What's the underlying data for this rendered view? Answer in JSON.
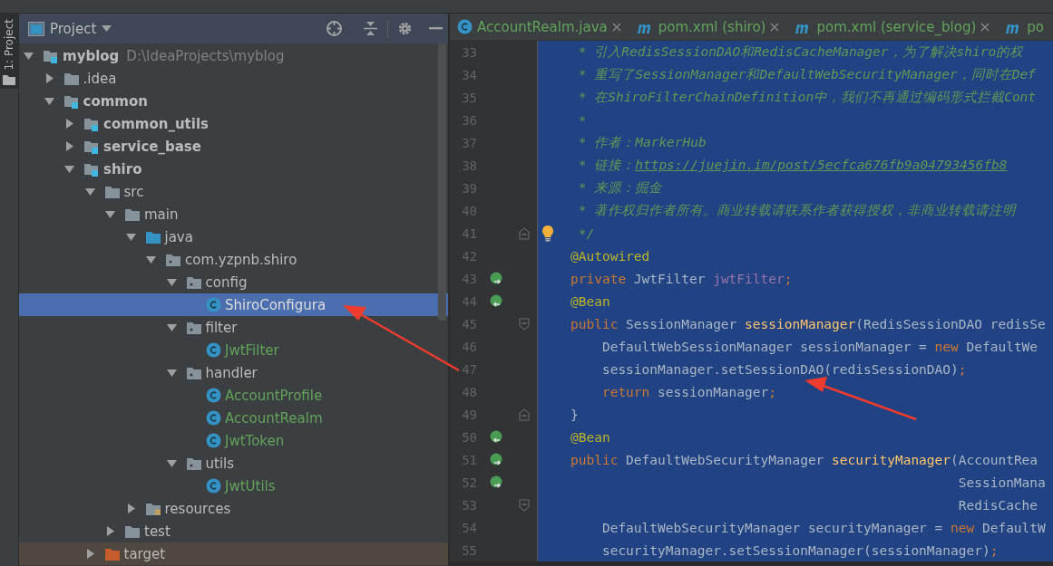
{
  "side_stripe": {
    "label": "1: Project"
  },
  "project_panel": {
    "title": "Project",
    "tree": [
      {
        "label": "myblog",
        "kind": "module",
        "path": "D:\\IdeaProjects\\myblog",
        "expanded": true,
        "selected": false,
        "children": [
          {
            "label": ".idea",
            "kind": "folder",
            "expanded": false,
            "selected": false
          },
          {
            "label": "common",
            "kind": "module",
            "expanded": true,
            "selected": false,
            "children": [
              {
                "label": "common_utils",
                "kind": "module",
                "expanded": false,
                "selected": false
              },
              {
                "label": "service_base",
                "kind": "module",
                "expanded": false,
                "selected": false
              },
              {
                "label": "shiro",
                "kind": "module",
                "expanded": true,
                "selected": false,
                "children": [
                  {
                    "label": "src",
                    "kind": "folder",
                    "expanded": true,
                    "selected": false,
                    "children": [
                      {
                        "label": "main",
                        "kind": "folder",
                        "expanded": true,
                        "selected": false,
                        "children": [
                          {
                            "label": "java",
                            "kind": "source",
                            "expanded": true,
                            "selected": false,
                            "children": [
                              {
                                "label": "com.yzpnb.shiro",
                                "kind": "package",
                                "expanded": true,
                                "selected": false,
                                "children": [
                                  {
                                    "label": "config",
                                    "kind": "package",
                                    "expanded": true,
                                    "selected": false,
                                    "children": [
                                      {
                                        "label": "ShiroConfigura",
                                        "kind": "class",
                                        "selected": true
                                      }
                                    ]
                                  },
                                  {
                                    "label": "filter",
                                    "kind": "package",
                                    "expanded": true,
                                    "selected": false,
                                    "children": [
                                      {
                                        "label": "JwtFilter",
                                        "kind": "class",
                                        "selected": false
                                      }
                                    ]
                                  },
                                  {
                                    "label": "handler",
                                    "kind": "package",
                                    "expanded": true,
                                    "selected": false,
                                    "children": [
                                      {
                                        "label": "AccountProfile",
                                        "kind": "class",
                                        "selected": false
                                      },
                                      {
                                        "label": "AccountRealm",
                                        "kind": "class",
                                        "selected": false
                                      },
                                      {
                                        "label": "JwtToken",
                                        "kind": "class",
                                        "selected": false
                                      }
                                    ]
                                  },
                                  {
                                    "label": "utils",
                                    "kind": "package",
                                    "expanded": true,
                                    "selected": false,
                                    "children": [
                                      {
                                        "label": "JwtUtils",
                                        "kind": "class",
                                        "selected": false
                                      }
                                    ]
                                  }
                                ]
                              }
                            ]
                          },
                          {
                            "label": "resources",
                            "kind": "resources",
                            "expanded": false,
                            "selected": false
                          }
                        ]
                      },
                      {
                        "label": "test",
                        "kind": "folder",
                        "expanded": false,
                        "selected": false
                      }
                    ]
                  },
                  {
                    "label": "target",
                    "kind": "excluded",
                    "expanded": false,
                    "selected": false
                  }
                ]
              }
            ]
          }
        ]
      }
    ]
  },
  "editor": {
    "tabs": [
      {
        "label": "AccountRealm.java",
        "kind": "class"
      },
      {
        "label": "pom.xml (shiro)",
        "kind": "maven"
      },
      {
        "label": "pom.xml (service_blog)",
        "kind": "maven"
      },
      {
        "label": "po",
        "kind": "maven"
      }
    ],
    "lines": [
      {
        "number": "33",
        "selected": true,
        "tokens": [
          {
            "kind": "comment",
            "text": " * 引入RedisSessionDAO和RedisCacheManager，为了解决shiro的权"
          }
        ]
      },
      {
        "number": "34",
        "selected": true,
        "tokens": [
          {
            "kind": "comment",
            "text": " * 重写了SessionManager和DefaultWebSecurityManager，同时在Def"
          }
        ]
      },
      {
        "number": "35",
        "selected": true,
        "tokens": [
          {
            "kind": "comment",
            "text": " * 在ShiroFilterChainDefinition中，我们不再通过编码形式拦截Cont"
          }
        ]
      },
      {
        "number": "36",
        "selected": true,
        "tokens": [
          {
            "kind": "comment",
            "text": " *"
          }
        ]
      },
      {
        "number": "37",
        "selected": true,
        "tokens": [
          {
            "kind": "comment",
            "text": " * 作者：MarkerHub"
          }
        ]
      },
      {
        "number": "38",
        "selected": true,
        "tokens": [
          {
            "kind": "comment",
            "text": " * 链接："
          },
          {
            "kind": "link",
            "text": "https://juejin.im/post/5ecfca676fb9a04793456fb8"
          }
        ]
      },
      {
        "number": "39",
        "selected": true,
        "tokens": [
          {
            "kind": "comment",
            "text": " * 来源：掘金"
          }
        ]
      },
      {
        "number": "40",
        "selected": true,
        "tokens": [
          {
            "kind": "comment",
            "text": " * 著作权归作者所有。商业转载请联系作者获得授权，非商业转载请注明"
          }
        ]
      },
      {
        "number": "41",
        "selected": true,
        "gutter": [
          {
            "kind": "bulb"
          },
          {
            "kind": "fold-end"
          }
        ],
        "tokens": [
          {
            "kind": "comment",
            "text": " */"
          }
        ]
      },
      {
        "number": "42",
        "selected": true,
        "tokens": [
          {
            "kind": "annotation",
            "text": "@Autowired"
          }
        ]
      },
      {
        "number": "43",
        "selected": true,
        "gutter": [
          {
            "kind": "bean-out"
          }
        ],
        "tokens": [
          {
            "kind": "keyword",
            "text": "private "
          },
          {
            "kind": "plain",
            "text": "JwtFilter "
          },
          {
            "kind": "field",
            "text": "jwtFilter"
          },
          {
            "kind": "keyword",
            "text": ";"
          }
        ]
      },
      {
        "number": "44",
        "selected": true,
        "gutter": [
          {
            "kind": "bean-in"
          }
        ],
        "tokens": [
          {
            "kind": "annotation",
            "text": "@Bean"
          }
        ]
      },
      {
        "number": "45",
        "selected": true,
        "gutter": [
          {
            "kind": "fold-start"
          }
        ],
        "tokens": [
          {
            "kind": "keyword",
            "text": "public "
          },
          {
            "kind": "plain",
            "text": "SessionManager "
          },
          {
            "kind": "method",
            "text": "sessionManager"
          },
          {
            "kind": "plain",
            "text": "(RedisSessionDAO redisSe"
          }
        ]
      },
      {
        "number": "46",
        "selected": true,
        "tokens": [
          {
            "kind": "plain",
            "text": "    DefaultWebSessionManager sessionManager = "
          },
          {
            "kind": "keyword",
            "text": "new "
          },
          {
            "kind": "plain",
            "text": "DefaultWe"
          }
        ]
      },
      {
        "number": "47",
        "selected": true,
        "tokens": [
          {
            "kind": "plain",
            "text": "    sessionManager.setSessionDAO(redisSessionDAO)"
          },
          {
            "kind": "keyword",
            "text": ";"
          }
        ]
      },
      {
        "number": "48",
        "selected": true,
        "tokens": [
          {
            "kind": "keyword",
            "text": "    return "
          },
          {
            "kind": "plain",
            "text": "sessionManager"
          },
          {
            "kind": "keyword",
            "text": ";"
          }
        ]
      },
      {
        "number": "49",
        "selected": true,
        "gutter": [
          {
            "kind": "fold-end"
          }
        ],
        "tokens": [
          {
            "kind": "plain",
            "text": "}"
          }
        ]
      },
      {
        "number": "50",
        "selected": true,
        "gutter": [
          {
            "kind": "bean-in"
          }
        ],
        "tokens": [
          {
            "kind": "annotation",
            "text": "@Bean"
          }
        ]
      },
      {
        "number": "51",
        "selected": true,
        "gutter": [
          {
            "kind": "bean-out"
          }
        ],
        "tokens": [
          {
            "kind": "keyword",
            "text": "public "
          },
          {
            "kind": "plain",
            "text": "DefaultWebSecurityManager "
          },
          {
            "kind": "method",
            "text": "securityManager"
          },
          {
            "kind": "plain",
            "text": "(AccountRea"
          }
        ]
      },
      {
        "number": "52",
        "selected": true,
        "gutter": [
          {
            "kind": "bean-out"
          }
        ],
        "tokens": [
          {
            "kind": "plain",
            "text": "                                                 SessionMana"
          }
        ]
      },
      {
        "number": "53",
        "selected": true,
        "gutter": [
          {
            "kind": "fold-start"
          }
        ],
        "tokens": [
          {
            "kind": "plain",
            "text": "                                                 RedisCache"
          }
        ]
      },
      {
        "number": "54",
        "selected": true,
        "tokens": [
          {
            "kind": "plain",
            "text": "    DefaultWebSecurityManager securityManager = "
          },
          {
            "kind": "keyword",
            "text": "new "
          },
          {
            "kind": "plain",
            "text": "DefaultW"
          }
        ]
      },
      {
        "number": "55",
        "selected": true,
        "tokens": [
          {
            "kind": "plain",
            "text": "    securityManager.setSessionManager(sessionManager)"
          },
          {
            "kind": "keyword",
            "text": ";"
          }
        ]
      }
    ]
  }
}
